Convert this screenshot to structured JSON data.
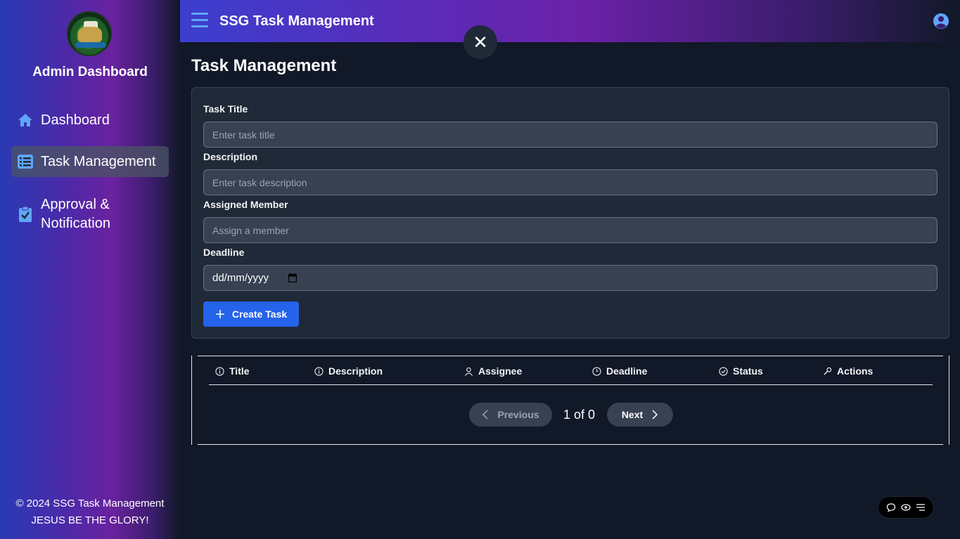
{
  "sidebar": {
    "title": "Admin Dashboard",
    "items": [
      {
        "label": "Dashboard",
        "icon": "home-icon"
      },
      {
        "label": "Task Management",
        "icon": "list-icon",
        "active": true
      },
      {
        "label": "Approval &",
        "label2": "Notification",
        "icon": "clipboard-check-icon"
      }
    ],
    "footer": {
      "copyright": "© 2024 SSG Task Management",
      "motto": "JESUS BE THE GLORY!"
    }
  },
  "header": {
    "title": "SSG Task Management",
    "close_symbol": "✕"
  },
  "main": {
    "page_title": "Task Management",
    "form": {
      "title_label": "Task Title",
      "title_placeholder": "Enter task title",
      "description_label": "Description",
      "description_placeholder": "Enter task description",
      "member_label": "Assigned Member",
      "member_placeholder": "Assign a member",
      "deadline_label": "Deadline",
      "deadline_value": "dd/mm/yyyy",
      "create_label": "Create Task"
    },
    "table": {
      "columns": [
        "Title",
        "Description",
        "Assignee",
        "Deadline",
        "Status",
        "Actions"
      ],
      "rows": []
    },
    "pagination": {
      "previous": "Previous",
      "page_info": "1 of 0",
      "next": "Next"
    }
  },
  "colors": {
    "accent": "#2563eb",
    "icon_blue": "#60a5fa",
    "background": "#111827",
    "card": "#1f2937"
  }
}
